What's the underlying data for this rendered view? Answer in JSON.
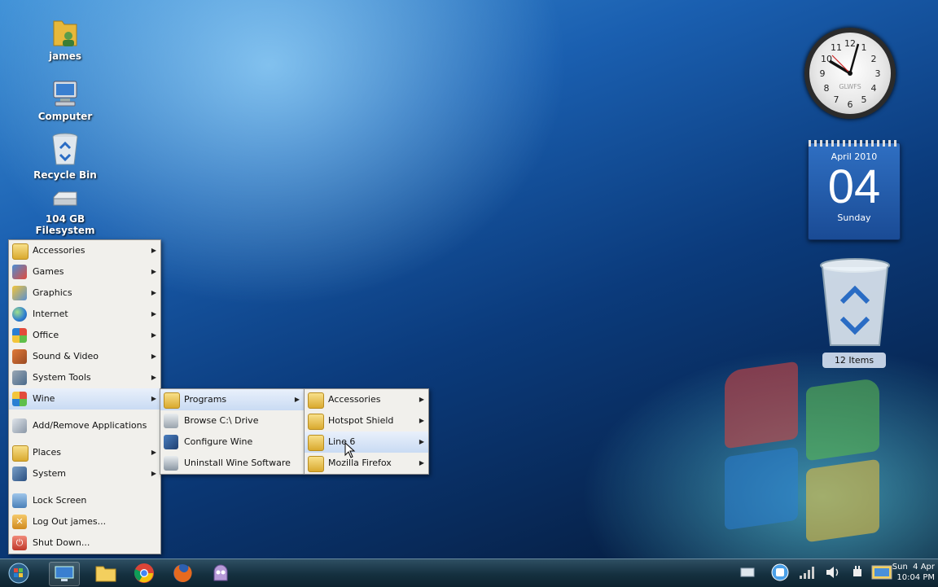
{
  "desktop": {
    "icons": [
      {
        "label": "james",
        "icon": "home-folder-icon"
      },
      {
        "label": "Computer",
        "icon": "computer-icon"
      },
      {
        "label": "Recycle Bin",
        "icon": "recycle-bin-icon"
      },
      {
        "label": "104 GB Filesystem",
        "icon": "drive-icon"
      }
    ]
  },
  "widgets": {
    "clock": {
      "brand": "GLWFS"
    },
    "calendar": {
      "month": "April 2010",
      "day": "04",
      "weekday": "Sunday"
    },
    "recycle_bin": {
      "label": "12 Items"
    }
  },
  "main_menu": {
    "items": [
      {
        "label": "Accessories"
      },
      {
        "label": "Games"
      },
      {
        "label": "Graphics"
      },
      {
        "label": "Internet"
      },
      {
        "label": "Office"
      },
      {
        "label": "Sound & Video"
      },
      {
        "label": "System Tools"
      },
      {
        "label": "Wine"
      },
      {
        "label": "Add/Remove Applications"
      },
      {
        "label": "Places"
      },
      {
        "label": "System"
      },
      {
        "label": "Lock Screen"
      },
      {
        "label": "Log Out james..."
      },
      {
        "label": "Shut Down..."
      }
    ]
  },
  "wine_menu": {
    "items": [
      {
        "label": "Programs"
      },
      {
        "label": "Browse C:\\ Drive"
      },
      {
        "label": "Configure Wine"
      },
      {
        "label": "Uninstall Wine Software"
      }
    ]
  },
  "programs_menu": {
    "items": [
      {
        "label": "Accessories"
      },
      {
        "label": "Hotspot Shield"
      },
      {
        "label": "Line 6"
      },
      {
        "label": "Mozilla Firefox"
      }
    ]
  },
  "tray": {
    "day": "Sun",
    "date": "4 Apr",
    "time": "10:04 PM"
  },
  "colors": {
    "menu_bg": "#f1f0ec",
    "highlight": "#c9dbf3",
    "taskbar": "#15303f"
  }
}
